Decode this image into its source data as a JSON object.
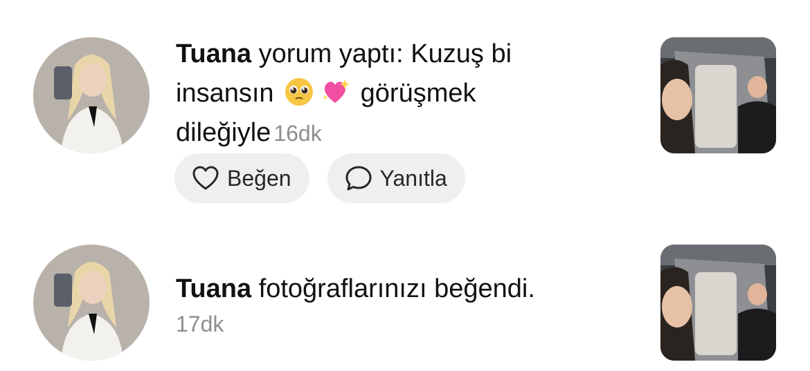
{
  "notifications": [
    {
      "username": "Tuana",
      "action_text": " yorum yaptı: Kuzuş bi insansın ",
      "comment_tail": " görüşmek dileğiyle",
      "emojis": [
        "pleading-face-emoji",
        "sparkling-heart-emoji"
      ],
      "timestamp": "16dk",
      "actions": {
        "like_label": "Beğen",
        "reply_label": "Yanıtla"
      }
    },
    {
      "username": "Tuana",
      "action_text": " fotoğraflarınızı beğendi.",
      "timestamp": "17dk"
    }
  ],
  "icons": {
    "like": "heart-outline-icon",
    "reply": "speech-bubble-icon"
  },
  "colors": {
    "pill_bg": "#efefef",
    "timestamp": "#8e8e8e",
    "text": "#111111"
  }
}
